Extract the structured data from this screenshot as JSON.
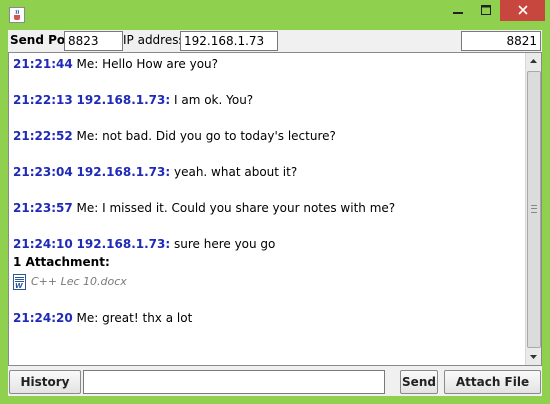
{
  "window": {
    "icon": "java-cup-icon",
    "controls": {
      "minimize": "—",
      "maximize": "□",
      "close": "×"
    }
  },
  "connection": {
    "send_port_label": "Send Port",
    "send_port_value": "8823",
    "ip_label": "IP address",
    "ip_value": "192.168.1.73",
    "listen_port_value": "8821"
  },
  "chat": {
    "messages": [
      {
        "time": "21:21:44",
        "sender": "Me:",
        "text": "Hello How are you?"
      },
      {
        "time": "21:22:13",
        "sender": "192.168.1.73:",
        "text": "I am ok. You?"
      },
      {
        "time": "21:22:52",
        "sender": "Me:",
        "text": "not bad. Did you go to today's lecture?"
      },
      {
        "time": "21:23:04",
        "sender": "192.168.1.73:",
        "text": "yeah. what about it?"
      },
      {
        "time": "21:23:57",
        "sender": "Me:",
        "text": "I missed it. Could you share your notes with me?"
      },
      {
        "time": "21:24:10",
        "sender": "192.168.1.73:",
        "text": "sure here you go"
      },
      {
        "time": "21:24:20",
        "sender": "Me:",
        "text": "great! thx a lot"
      }
    ],
    "attachment": {
      "title": "1 Attachment:",
      "file_name": "C++ Lec 10.docx",
      "icon": "word-document-icon"
    }
  },
  "bottom": {
    "history_label": "History",
    "message_value": "",
    "send_label": "Send",
    "attach_label": "Attach File"
  },
  "colors": {
    "frame": "#8fd14f",
    "timestamp": "#1f2ab8",
    "close_button": "#c7463d"
  }
}
